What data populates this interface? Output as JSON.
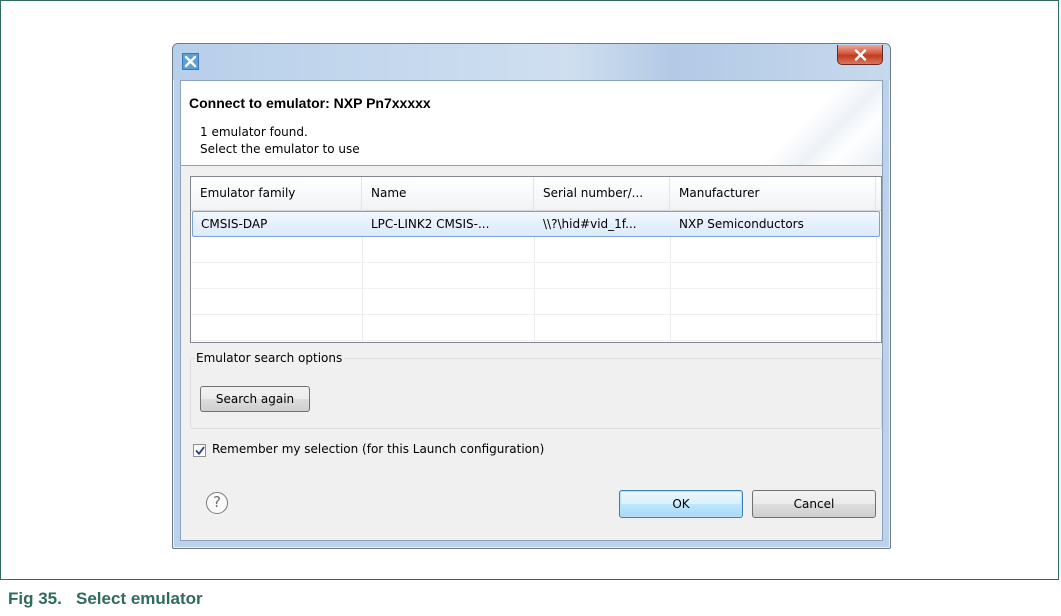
{
  "figure": {
    "caption": "Fig 35.   Select emulator"
  },
  "dialog": {
    "title": "Connect to emulator: NXP Pn7xxxxx",
    "message_line1": "1 emulator found.",
    "message_line2": "Select the emulator to use",
    "app_icon": "x-app-icon",
    "close_icon": "close-icon"
  },
  "table": {
    "columns": [
      "Emulator family",
      "Name",
      "Serial number/...",
      "Manufacturer"
    ],
    "rows": [
      [
        "CMSIS-DAP",
        "LPC-LINK2 CMSIS-...",
        "\\\\?\\hid#vid_1f...",
        "NXP Semiconductors"
      ]
    ],
    "selected_row": 0
  },
  "search_options": {
    "group_label": "Emulator search options",
    "search_button": "Search again"
  },
  "remember": {
    "label": "Remember my selection (for this Launch configuration)",
    "checked": true
  },
  "footer": {
    "help_glyph": "?",
    "ok_label": "OK",
    "cancel_label": "Cancel"
  },
  "colors": {
    "caption": "#2f6b5e",
    "selection": "#dbeafc",
    "ok_focus": "#3c7fb1"
  }
}
